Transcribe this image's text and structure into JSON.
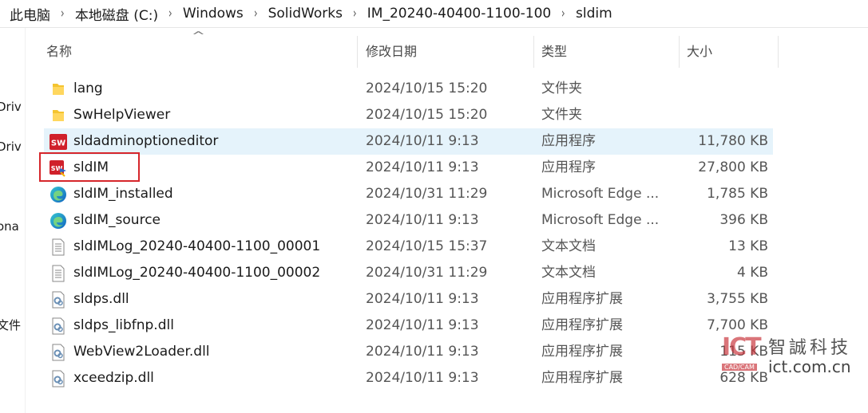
{
  "breadcrumb": [
    "此电脑",
    "本地磁盘 (C:)",
    "Windows",
    "SolidWorks",
    "IM_20240-40400-1100-100",
    "sldim"
  ],
  "nav_pane": [
    "Driv",
    "Driv",
    "ona",
    "文件"
  ],
  "columns": {
    "name": "名称",
    "date": "修改日期",
    "type": "类型",
    "size": "大小"
  },
  "files": [
    {
      "name": "lang",
      "date": "2024/10/15 15:20",
      "type": "文件夹",
      "size": "",
      "icon": "folder-icon"
    },
    {
      "name": "SwHelpViewer",
      "date": "2024/10/15 15:20",
      "type": "文件夹",
      "size": "",
      "icon": "folder-icon"
    },
    {
      "name": "sldadminoptioneditor",
      "date": "2024/10/11 9:13",
      "type": "应用程序",
      "size": "11,780 KB",
      "icon": "solidworks-app-icon"
    },
    {
      "name": "sldIM",
      "date": "2024/10/11 9:13",
      "type": "应用程序",
      "size": "27,800 KB",
      "icon": "solidworks-installer-icon"
    },
    {
      "name": "sldIM_installed",
      "date": "2024/10/31 11:29",
      "type": "Microsoft Edge ...",
      "size": "1,785 KB",
      "icon": "edge-icon"
    },
    {
      "name": "sldIM_source",
      "date": "2024/10/11 9:13",
      "type": "Microsoft Edge ...",
      "size": "396 KB",
      "icon": "edge-icon"
    },
    {
      "name": "sldIMLog_20240-40400-1100_00001",
      "date": "2024/10/15 15:37",
      "type": "文本文档",
      "size": "13 KB",
      "icon": "text-document-icon"
    },
    {
      "name": "sldIMLog_20240-40400-1100_00002",
      "date": "2024/10/31 11:29",
      "type": "文本文档",
      "size": "4 KB",
      "icon": "text-document-icon"
    },
    {
      "name": "sldps.dll",
      "date": "2024/10/11 9:13",
      "type": "应用程序扩展",
      "size": "3,755 KB",
      "icon": "dll-icon"
    },
    {
      "name": "sldps_libfnp.dll",
      "date": "2024/10/11 9:13",
      "type": "应用程序扩展",
      "size": "7,700 KB",
      "icon": "dll-icon"
    },
    {
      "name": "WebView2Loader.dll",
      "date": "2024/10/11 9:13",
      "type": "应用程序扩展",
      "size": "115 KB",
      "icon": "dll-icon"
    },
    {
      "name": "xceedzip.dll",
      "date": "2024/10/11 9:13",
      "type": "应用程序扩展",
      "size": "628 KB",
      "icon": "dll-icon"
    }
  ],
  "watermark": {
    "logo": "ICT",
    "logo_sub": "CAD/CAM",
    "chinese": "智誠科技",
    "url": "ict.com.cn"
  },
  "colors": {
    "selection": "#e5f3fb",
    "highlight_box": "#d6262b",
    "folder": "#f4c430"
  }
}
